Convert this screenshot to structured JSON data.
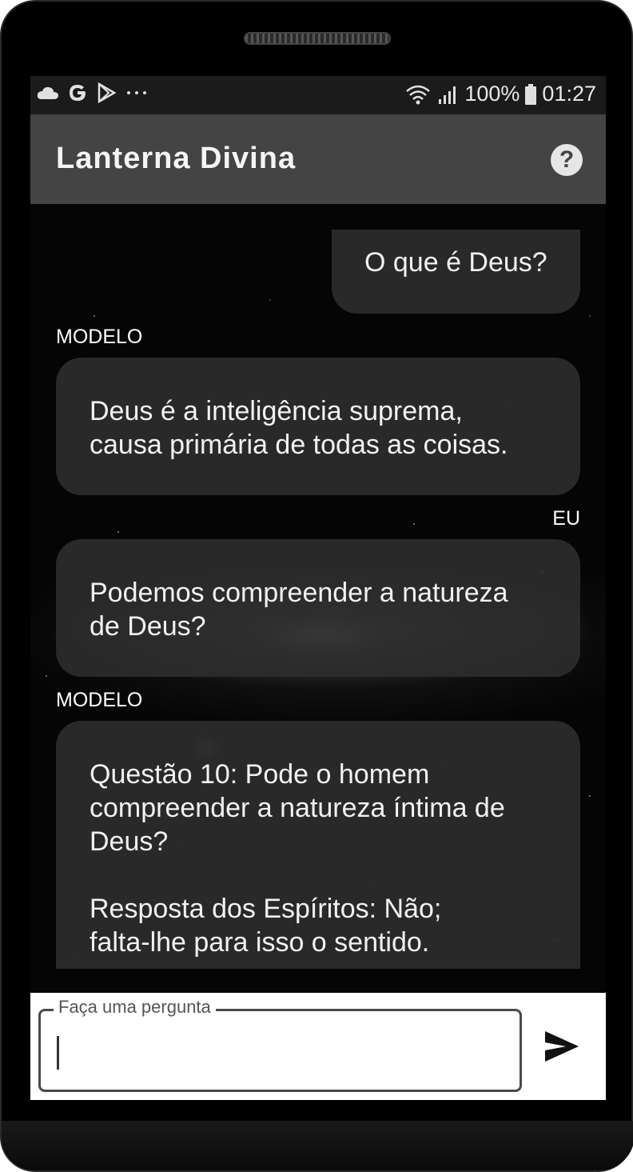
{
  "status_bar": {
    "battery_percent": "100%",
    "time": "01:27",
    "left_icons": [
      "cloud-icon",
      "google-icon",
      "play-icon",
      "more-dots-icon"
    ],
    "right_icons": [
      "wifi-icon",
      "signal-icon",
      "battery-icon"
    ]
  },
  "app_bar": {
    "title": "Lanterna Divina",
    "help_icon": "help-circle-icon",
    "help_symbol": "?"
  },
  "messages": [
    {
      "sender": "",
      "text": "O que é Deus?"
    },
    {
      "sender": "MODELO",
      "text": "Deus é a inteligência suprema,\ncausa primária de todas as coisas."
    },
    {
      "sender": "EU",
      "text": "Podemos compreender a natureza\nde Deus?"
    },
    {
      "sender": "MODELO",
      "text": "Questão 10: Pode o homem\ncompreender a natureza íntima de\nDeus?\n\nResposta dos Espíritos: Não;\nfalta-lhe para isso o sentido."
    }
  ],
  "input": {
    "label": "Faça uma pergunta",
    "value": "",
    "send_icon": "send-icon"
  },
  "colors": {
    "app_bar": "#444444",
    "status_bar": "#1b1b1b",
    "bubble": "#2d2d2d",
    "background": "#050505"
  }
}
